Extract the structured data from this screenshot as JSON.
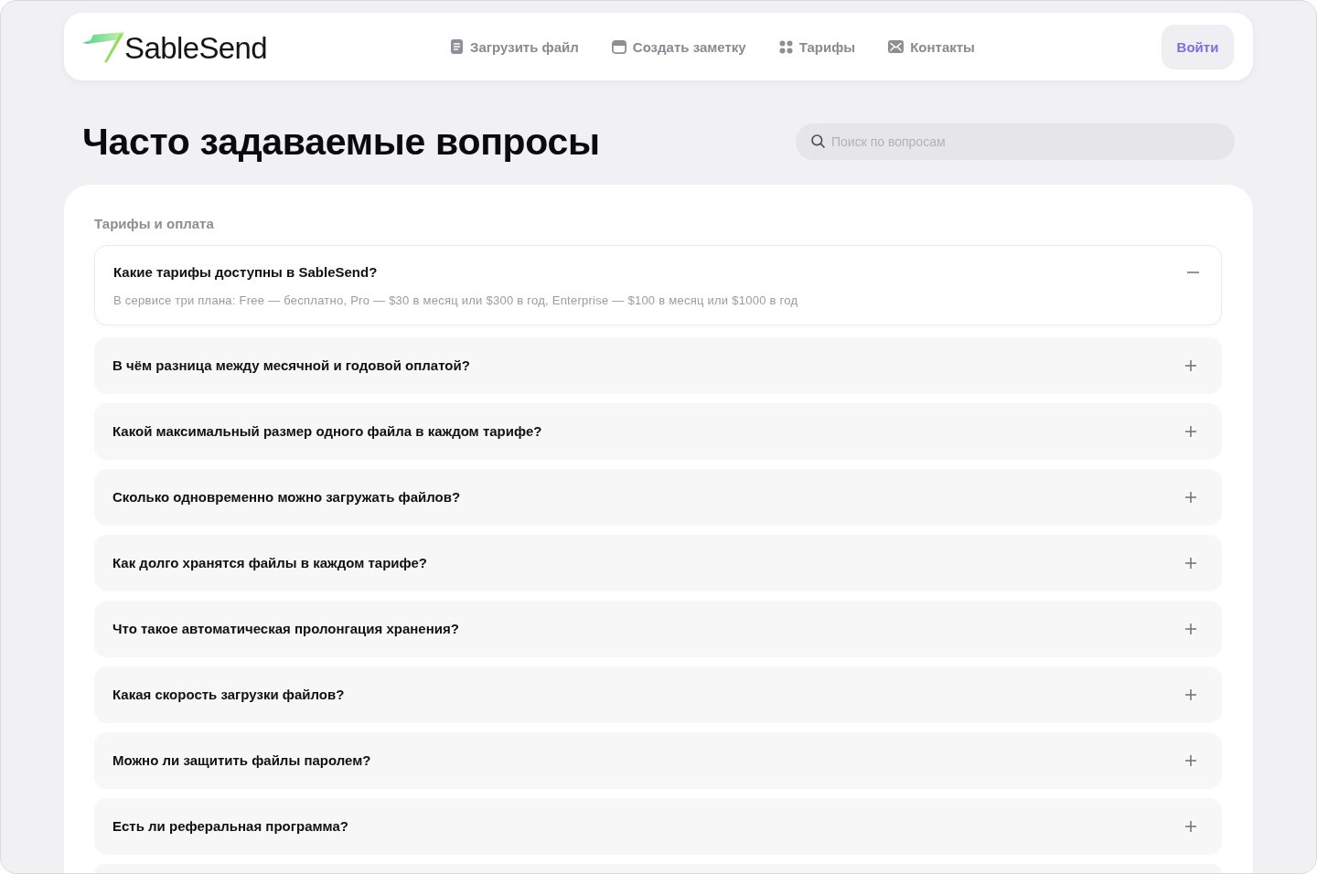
{
  "header": {
    "logo": "SableSend",
    "nav": [
      {
        "label": "Загрузить файл"
      },
      {
        "label": "Создать заметку"
      },
      {
        "label": "Тарифы"
      },
      {
        "label": "Контакты"
      }
    ],
    "login_button": "Войти"
  },
  "page_title": "Часто задаваемые вопросы",
  "search": {
    "placeholder": "Поиск по вопросам"
  },
  "faq": {
    "section_title": "Тарифы и оплата",
    "items": [
      {
        "question": "Какие тарифы доступны в SableSend?",
        "answer": "В сервисе три плана: Free — бесплатно, Pro — $30 в месяц или $300 в год, Enterprise — $100 в месяц или $1000 в год",
        "expanded": true
      },
      {
        "question": "В чём разница между месячной и годовой оплатой?",
        "expanded": false
      },
      {
        "question": "Какой максимальный размер одного файла в каждом тарифе?",
        "expanded": false
      },
      {
        "question": "Сколько одновременно можно загружать файлов?",
        "expanded": false
      },
      {
        "question": "Как долго хранятся файлы в каждом тарифе?",
        "expanded": false
      },
      {
        "question": "Что такое автоматическая пролонгация хранения?",
        "expanded": false
      },
      {
        "question": "Какая скорость загрузки файлов?",
        "expanded": false
      },
      {
        "question": "Можно ли защитить файлы паролем?",
        "expanded": false
      },
      {
        "question": "Есть ли реферальная программа?",
        "expanded": false
      }
    ]
  }
}
